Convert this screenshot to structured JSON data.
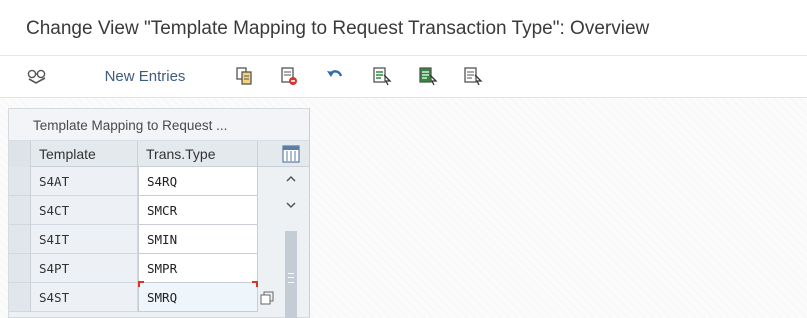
{
  "window": {
    "title": "Change View \"Template Mapping to Request Transaction Type\": Overview"
  },
  "toolbar": {
    "new_entries_label": "New Entries",
    "icons": [
      "display-change-icon",
      "copy-icon",
      "delete-icon",
      "undo-icon",
      "select-all-icon",
      "select-block-icon",
      "deselect-all-icon"
    ]
  },
  "table": {
    "caption": "Template Mapping to Request ...",
    "columns": [
      "Template",
      "Trans.Type"
    ],
    "rows": [
      {
        "template": "S4AT",
        "trans_type": "S4RQ"
      },
      {
        "template": "S4CT",
        "trans_type": "SMCR"
      },
      {
        "template": "S4IT",
        "trans_type": "SMIN"
      },
      {
        "template": "S4PT",
        "trans_type": "SMPR"
      },
      {
        "template": "S4ST",
        "trans_type": "SMRQ"
      }
    ]
  },
  "colors": {
    "accent": "#2f6fae",
    "delete_red": "#d9342b",
    "focus_corner": "#d9342b"
  }
}
